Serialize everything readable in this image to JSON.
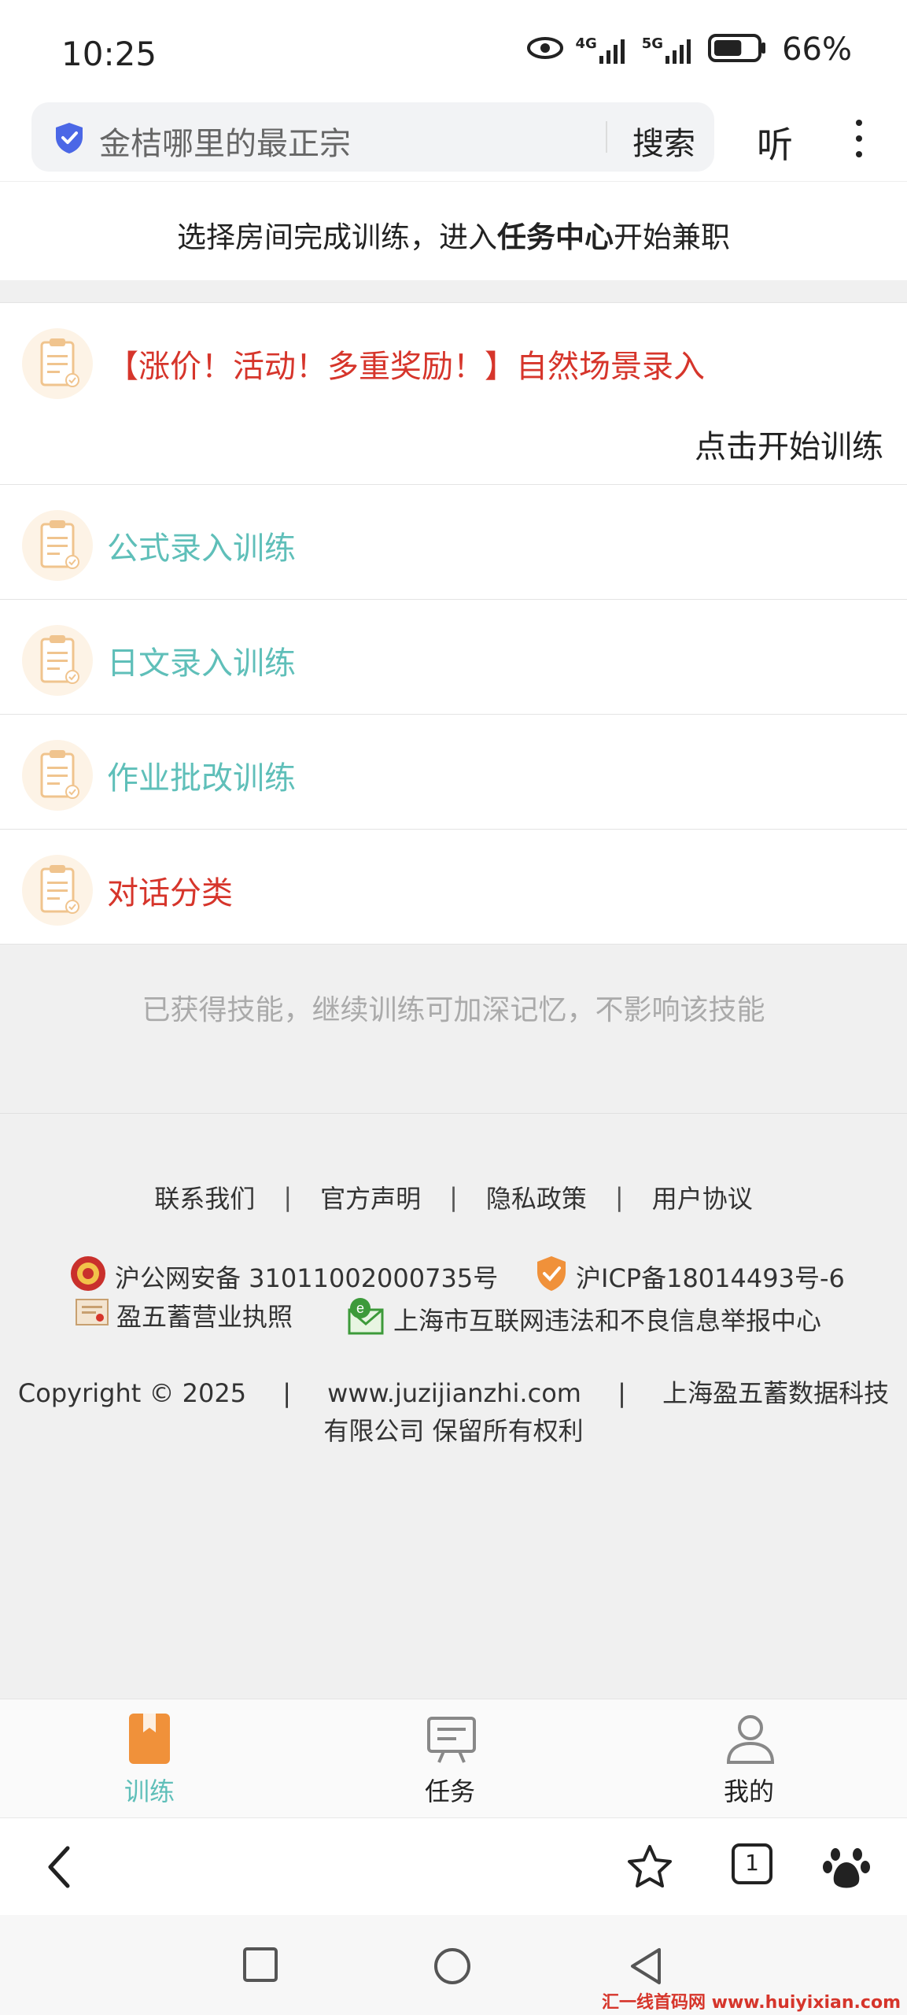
{
  "status_bar": {
    "time": "10:25",
    "net_4g": "4G",
    "net_5g": "5G",
    "battery_percent": 66,
    "battery_text": "66%"
  },
  "address_bar": {
    "search_text": "金桔哪里的最正宗",
    "search_button": "搜索",
    "listen_button": "听"
  },
  "page": {
    "subtitle_before": "选择房间完成训练，进入",
    "subtitle_bold": "任务中心",
    "subtitle_after": "开始兼职"
  },
  "list": {
    "items": [
      {
        "label": "【涨价！活动！多重奖励！】自然场景录入",
        "color": "#d6352b",
        "action": "点击开始训练"
      },
      {
        "label": "公式录入训练",
        "color": "#5fbfb9"
      },
      {
        "label": "日文录入训练",
        "color": "#5fbfb9"
      },
      {
        "label": "作业批改训练",
        "color": "#5fbfb9"
      },
      {
        "label": "对话分类",
        "color": "#d6352b"
      }
    ]
  },
  "note": "已获得技能，继续训练可加深记忆，不影响该技能",
  "footer": {
    "links": [
      "联系我们",
      "官方声明",
      "隐私政策",
      "用户协议"
    ],
    "separator": "|",
    "police_record": "沪公网安备 31011002000735号",
    "icp_record": "沪ICP备18014493号-6",
    "business_license": "盈五蓄营业执照",
    "report_center": "上海市互联网违法和不良信息举报中心",
    "copyright": "Copyright © 2025",
    "website": "www.juzijianzhi.com",
    "company_line1": "上海盈五蓄数据科技",
    "company_line2": "有限公司 保留所有权利"
  },
  "tabbar": {
    "tabs": [
      {
        "label": "训练",
        "icon": "book-icon",
        "active": true
      },
      {
        "label": "任务",
        "icon": "task-board-icon",
        "active": false
      },
      {
        "label": "我的",
        "icon": "user-icon",
        "active": false
      }
    ]
  },
  "browser_nav": {
    "tab_count": "1"
  },
  "watermark": "汇一线首码网 www.huiyixian.com",
  "colors": {
    "accent_teal": "#5fbfb9",
    "accent_red": "#d6352b",
    "tab_orange": "#f0913a"
  }
}
